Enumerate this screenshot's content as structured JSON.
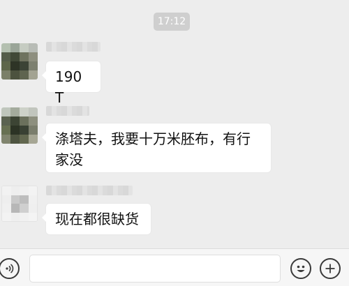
{
  "status": {
    "time": "17:12"
  },
  "messages": [
    {
      "text": "190 T"
    },
    {
      "text": "涤塔夫，我要十万米胚布，有行家没"
    },
    {
      "text": "现在都很缺货"
    }
  ],
  "input_bar": {
    "voice_icon": "voice-icon",
    "emoji_icon": "emoji-icon",
    "plus_icon": "plus-icon",
    "input_value": ""
  },
  "colors": {
    "background": "#ededed",
    "bubble": "#ffffff",
    "time_pill": "#cfcfcf",
    "input_bar": "#f6f6f6"
  }
}
